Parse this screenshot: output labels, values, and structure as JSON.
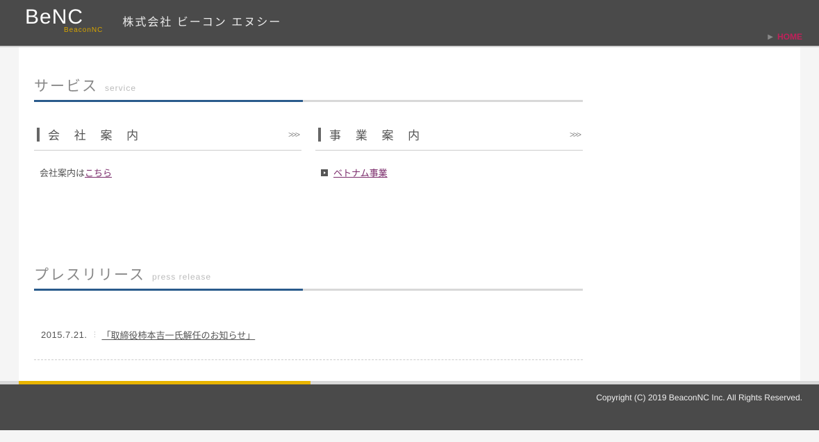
{
  "header": {
    "logo_main": "BeNC",
    "logo_sub": "BeaconNC",
    "company_name": "株式会社 ビーコン エヌシー",
    "nav_home": "HOME"
  },
  "service_section": {
    "title_jp": "サービス",
    "title_en": "service"
  },
  "cards": {
    "company": {
      "title": "会 社 案 内",
      "body_prefix": "会社案内は",
      "body_link": "こちら"
    },
    "business": {
      "title": "事 業 案 内",
      "link_label": "ベトナム事業"
    }
  },
  "press_section": {
    "title_jp": "プレスリリース",
    "title_en": "press release",
    "items": [
      {
        "date": "2015.7.21.",
        "title": "「取締役柿本吉一氏解任のお知らせ」"
      }
    ]
  },
  "footer": {
    "copyright": "Copyright (C) 2019 BeaconNC Inc. All Rights Reserved."
  }
}
